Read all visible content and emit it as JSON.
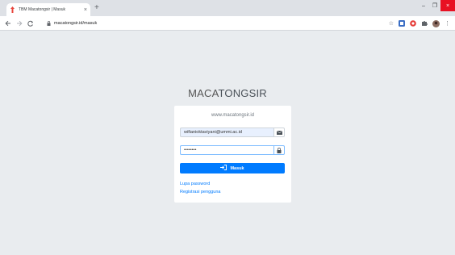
{
  "browser": {
    "tab_title": "TBM Macatongsir | Masuk",
    "tab_close": "×",
    "new_tab": "+",
    "url": "macatongsir.id/masuk",
    "win_minimize": "–",
    "win_restore": "❐",
    "win_close": "×"
  },
  "page": {
    "brand_part1": "MACA",
    "brand_part2": "TONGSIR",
    "site_label": "www.macatongsir.id",
    "email_value": "wifianioktaviyani@ummi.ac.id",
    "password_value": "••••••••",
    "login_label": "Masuk",
    "forgot_link": "Lupa password",
    "register_link": "Registrasi pengguna"
  },
  "colors": {
    "primary": "#007bff",
    "background": "#e9ecef",
    "close_red": "#e81123"
  }
}
